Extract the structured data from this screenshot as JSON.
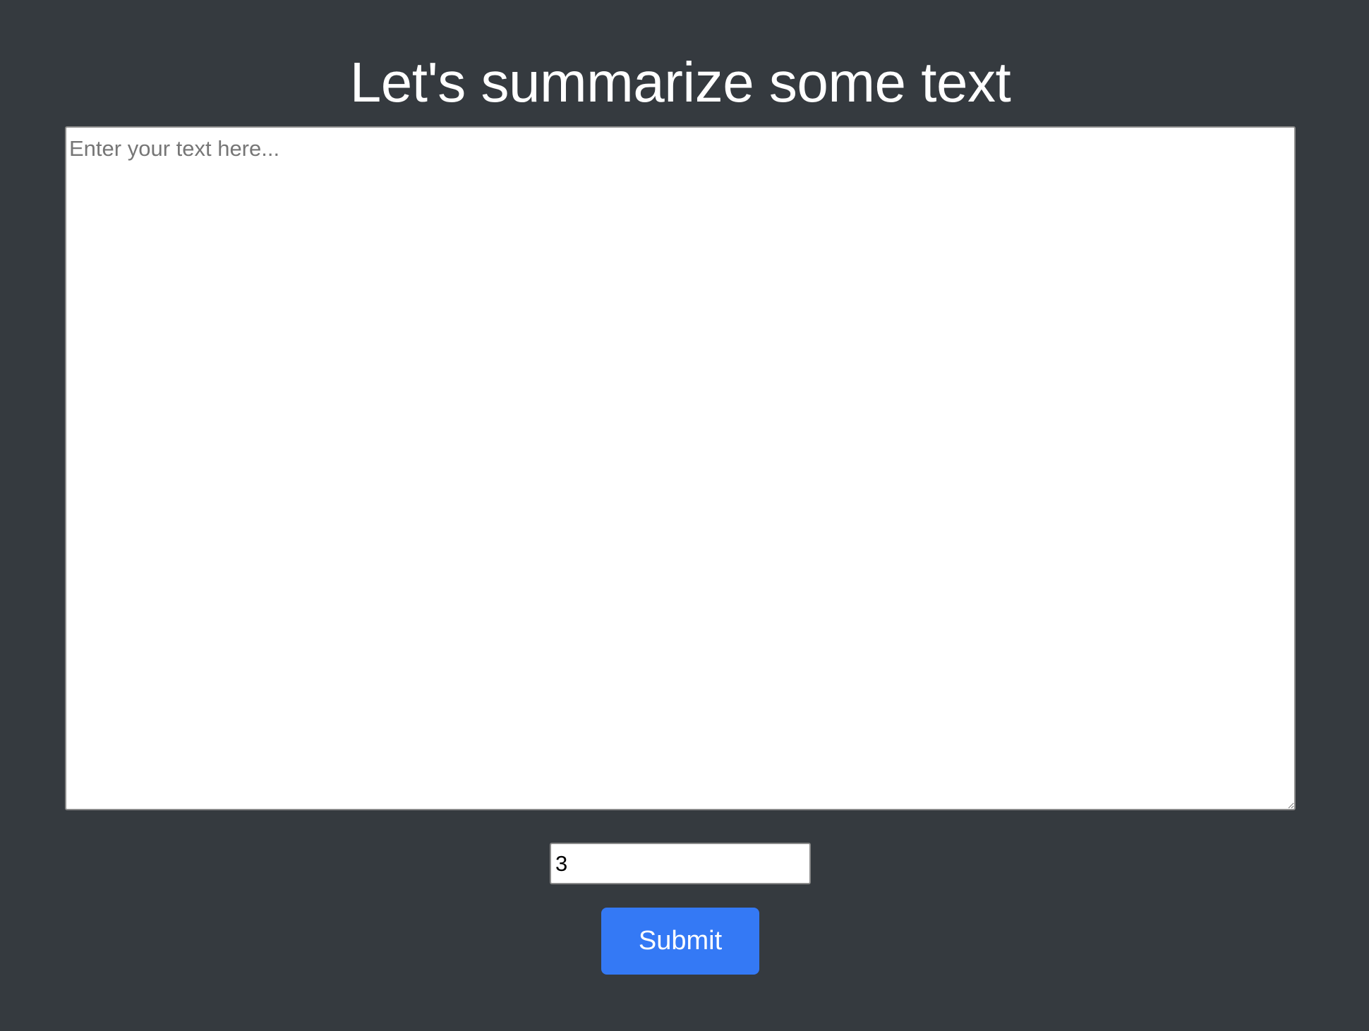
{
  "page": {
    "title": "Let's summarize some text"
  },
  "form": {
    "text_placeholder": "Enter your text here...",
    "text_value": "",
    "count_value": "3",
    "submit_label": "Submit"
  },
  "colors": {
    "background": "#353a3f",
    "accent": "#3479f5",
    "field_background": "#ffffff"
  }
}
